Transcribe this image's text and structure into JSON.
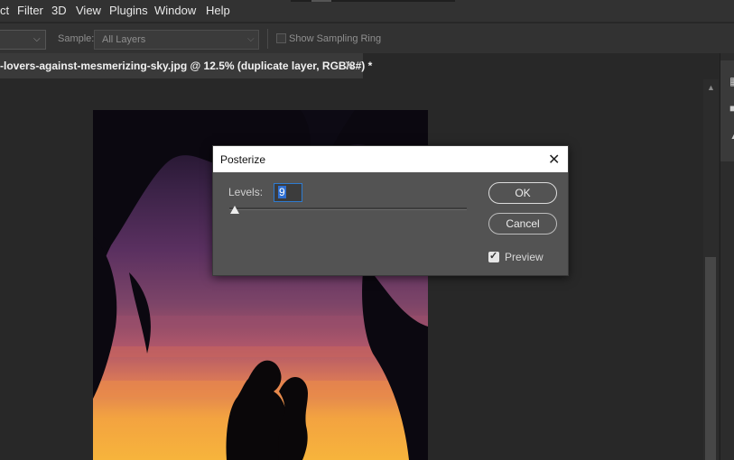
{
  "menubar": {
    "items": [
      "ct",
      "Filter",
      "3D",
      "View",
      "Plugins",
      "Window",
      "Help"
    ]
  },
  "options": {
    "sample_label": "Sample:",
    "sample_value": "All Layers",
    "sampling_ring_label": "Show Sampling Ring"
  },
  "document_tab": {
    "title": "-lovers-against-mesmerizing-sky.jpg @ 12.5% (duplicate layer, RGB/8#) *",
    "close": "✕"
  },
  "dialog": {
    "title": "Posterize",
    "close": "✕",
    "levels_label": "Levels:",
    "levels_value": "9",
    "levels_fraction": 0.0,
    "ok_label": "OK",
    "cancel_label": "Cancel",
    "preview_label": "Preview",
    "preview_checked": true
  },
  "colors": {
    "menubar_bg": "#323232",
    "workspace_bg": "#282828",
    "dialog_bg": "#535353",
    "selection_blue": "#2f6fd1"
  }
}
